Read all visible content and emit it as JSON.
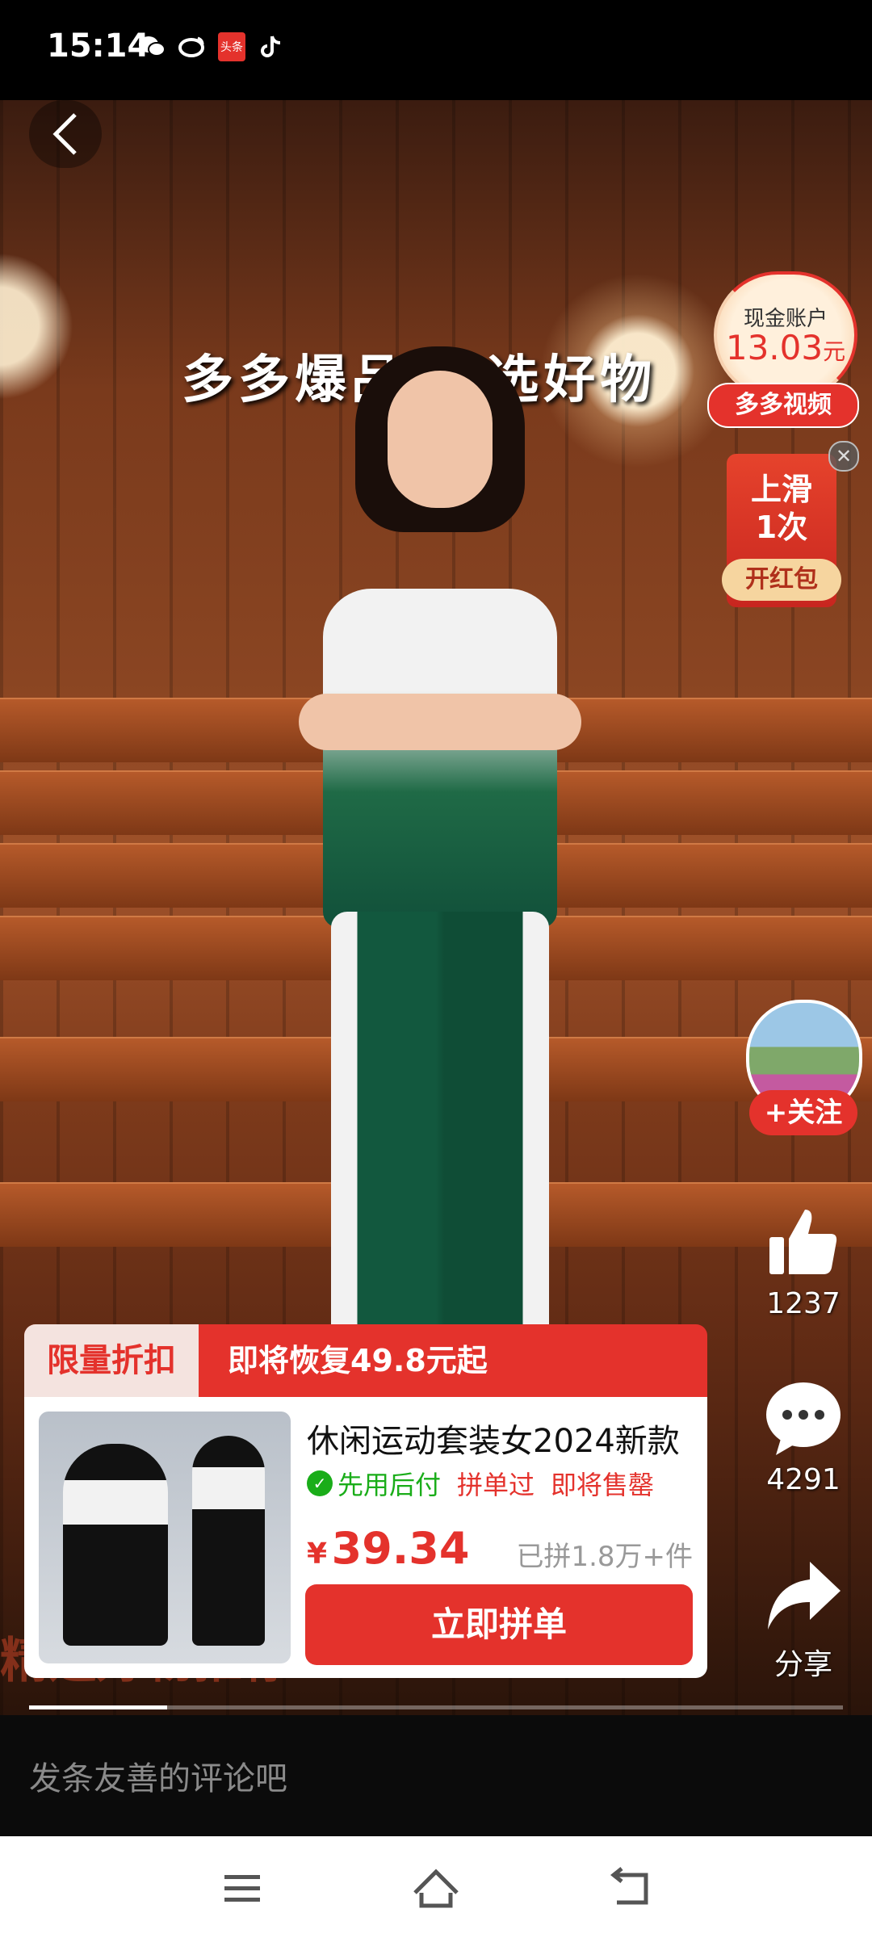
{
  "status_bar": {
    "time": "15:14",
    "icons": [
      "wechat-icon",
      "weibo-icon",
      "toutiao-icon",
      "tiktok-icon"
    ],
    "toutiao_label": "头条"
  },
  "video": {
    "banner_text": "多多爆品 优选好物",
    "overlay_text": "精选好物推荐",
    "progress": 0.17
  },
  "cash_account": {
    "label": "现金账户",
    "amount": "13.03",
    "unit": "元",
    "tag": "多多视频"
  },
  "red_packet": {
    "line1": "上滑",
    "line2": "1次",
    "button": "开红包"
  },
  "creator": {
    "follow_label": "+关注"
  },
  "actions": {
    "likes": "1237",
    "comments": "4291",
    "share": "分享"
  },
  "product_card": {
    "badge": "限量折扣",
    "promo": "即将恢复49.8元起",
    "title": "休闲运动套装女2024新款",
    "tag_pay_later": "先用后付",
    "tag_bought": "拼单过",
    "tag_selling_out": "即将售罄",
    "currency": "¥",
    "price": "39.34",
    "sold": "已拼1.8万+件",
    "buy_button": "立即拼单"
  },
  "comment_bar": {
    "placeholder": "发条友善的评论吧"
  },
  "colors": {
    "accent": "#e4322c",
    "green": "#1aad19"
  }
}
